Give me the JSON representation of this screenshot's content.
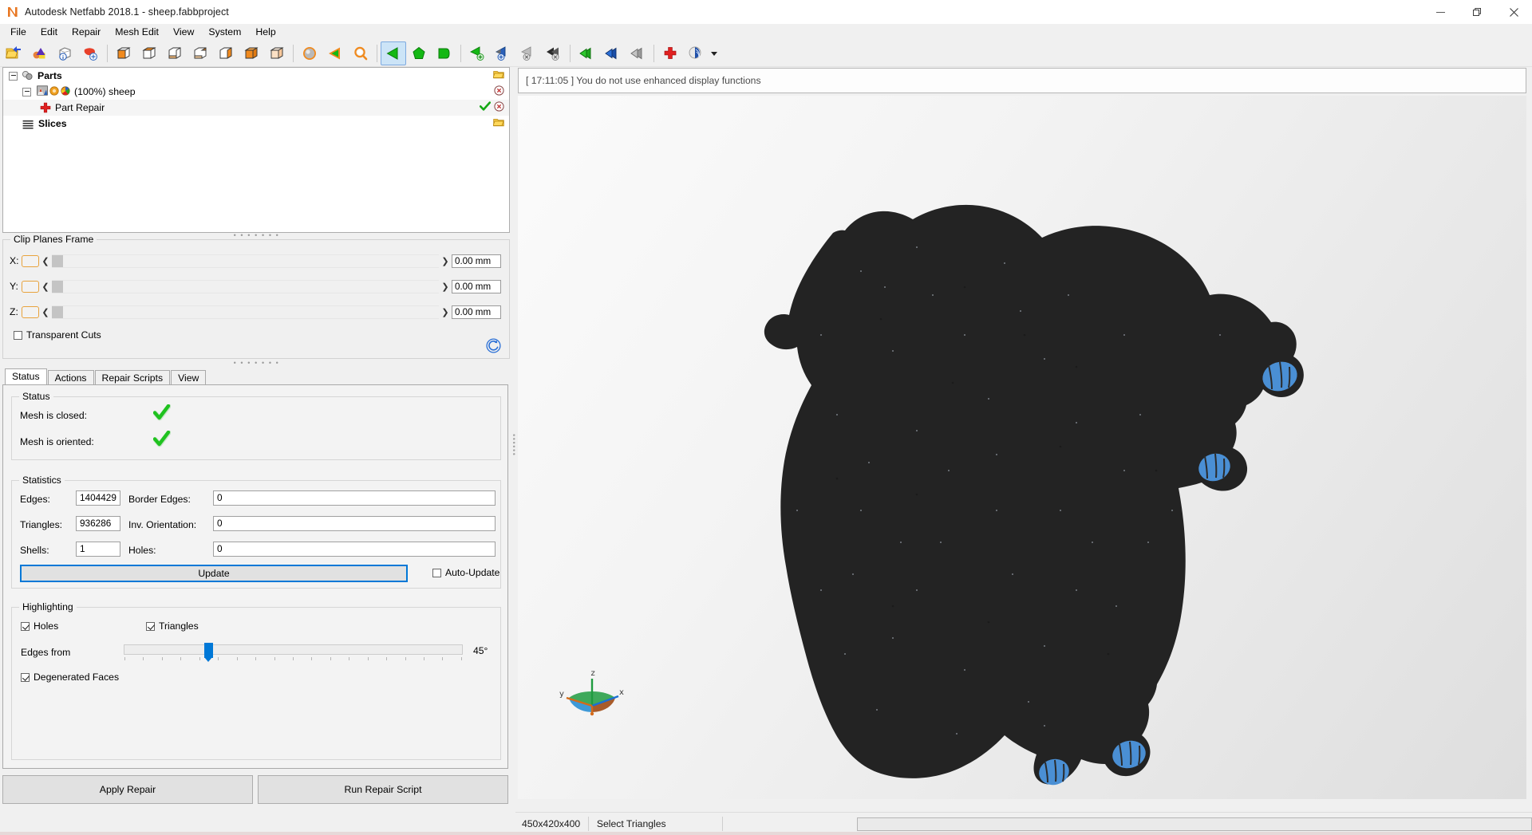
{
  "window": {
    "title": "Autodesk Netfabb 2018.1 - sheep.fabbproject",
    "logo_letter": "N",
    "controls": {
      "minimize": "minimize-icon",
      "maximize": "maximize-icon",
      "close": "close-icon"
    }
  },
  "menu": {
    "items": [
      {
        "label": "File"
      },
      {
        "label": "Edit"
      },
      {
        "label": "Repair"
      },
      {
        "label": "Mesh Edit"
      },
      {
        "label": "View"
      },
      {
        "label": "System"
      },
      {
        "label": "Help"
      }
    ]
  },
  "toolbar": {
    "groups": [
      {
        "buttons": [
          {
            "name": "open-project-icon",
            "tooltip": "Open Project"
          },
          {
            "name": "import-part-icon",
            "tooltip": "Import Part"
          },
          {
            "name": "part-info-icon",
            "tooltip": "Part Info"
          },
          {
            "name": "add-part-icon",
            "tooltip": "Add Part"
          }
        ]
      },
      {
        "buttons": [
          {
            "name": "view-cube-1-icon",
            "tooltip": "View Front"
          },
          {
            "name": "view-cube-2-icon",
            "tooltip": "View Top"
          },
          {
            "name": "view-cube-3-icon",
            "tooltip": "View Bottom"
          },
          {
            "name": "view-cube-4-icon",
            "tooltip": "View Left"
          },
          {
            "name": "view-cube-5-icon",
            "tooltip": "View Right"
          },
          {
            "name": "view-cube-6-icon",
            "tooltip": "View Back"
          },
          {
            "name": "view-cube-7-icon",
            "tooltip": "View Iso"
          }
        ]
      },
      {
        "buttons": [
          {
            "name": "shaded-sphere-icon",
            "tooltip": "Shading"
          },
          {
            "name": "orange-triangle-icon",
            "tooltip": "Triangle Display"
          },
          {
            "name": "zoom-icon",
            "tooltip": "Zoom"
          }
        ]
      },
      {
        "buttons": [
          {
            "name": "select-triangles-icon",
            "tooltip": "Select Triangles",
            "active": true
          },
          {
            "name": "select-surface-icon",
            "tooltip": "Select Surface"
          },
          {
            "name": "select-shell-icon",
            "tooltip": "Select Shell"
          }
        ]
      },
      {
        "buttons": [
          {
            "name": "add-selection-icon",
            "tooltip": "Add to Selection"
          },
          {
            "name": "invert-selection-icon",
            "tooltip": "Invert Selection"
          },
          {
            "name": "remove-selection-icon",
            "tooltip": "Remove from Selection"
          },
          {
            "name": "clear-selection-icon",
            "tooltip": "Clear Selection"
          }
        ]
      },
      {
        "buttons": [
          {
            "name": "select-green-icon",
            "tooltip": "Select"
          },
          {
            "name": "select-blue-icon",
            "tooltip": "Select Blue"
          },
          {
            "name": "select-gray-icon",
            "tooltip": "Deselect"
          }
        ]
      },
      {
        "buttons": [
          {
            "name": "repair-cross-icon",
            "tooltip": "Repair Part"
          },
          {
            "name": "render-mode-icon",
            "tooltip": "Render Mode",
            "has_dropdown": true
          }
        ]
      }
    ]
  },
  "tree": {
    "nodes": [
      {
        "label": "Parts",
        "bold": true,
        "icon": "parts-icon",
        "expander": "minus",
        "right_icons": [
          "folder-open-icon"
        ],
        "level": 0
      },
      {
        "label": "(100%) sheep",
        "bold": false,
        "icon": "mesh-part-icon",
        "extra_icons": [
          "orange-dot-icon",
          "color-wheel-icon"
        ],
        "expander": "minus",
        "right_icons": [
          "remove-icon"
        ],
        "level": 1
      },
      {
        "label": "Part Repair",
        "bold": false,
        "icon": "repair-cross-icon",
        "expander": "none",
        "right_icons": [
          "check-icon",
          "remove-icon"
        ],
        "selected": true,
        "level": 2
      },
      {
        "label": "Slices",
        "bold": true,
        "icon": "slices-icon",
        "expander": "none",
        "right_icons": [
          "folder-open-icon"
        ],
        "level": 0
      }
    ]
  },
  "clip_planes": {
    "title": "Clip Planes Frame",
    "axes": [
      {
        "label": "X:",
        "value": "0.00 mm",
        "swatch_color": "#e8a33d",
        "thumb_pos": 0
      },
      {
        "label": "Y:",
        "value": "0.00 mm",
        "swatch_color": "#e8a33d",
        "thumb_pos": 0
      },
      {
        "label": "Z:",
        "value": "0.00 mm",
        "swatch_color": "#e8a33d",
        "thumb_pos": 0
      }
    ],
    "transparent_cuts": {
      "label": "Transparent Cuts",
      "checked": false
    },
    "reset_icon": "reset-circular-arrow-icon"
  },
  "tabs": {
    "items": [
      {
        "label": "Status",
        "active": true
      },
      {
        "label": "Actions",
        "active": false
      },
      {
        "label": "Repair Scripts",
        "active": false
      },
      {
        "label": "View",
        "active": false
      }
    ]
  },
  "status_group": {
    "title": "Status",
    "rows": [
      {
        "label": "Mesh is closed:",
        "value_icon": "green-check-icon"
      },
      {
        "label": "Mesh is oriented:",
        "value_icon": "green-check-icon"
      }
    ]
  },
  "statistics_group": {
    "title": "Statistics",
    "rows": [
      {
        "left_label": "Edges:",
        "left_value": "1404429",
        "right_label": "Border Edges:",
        "right_value": "0"
      },
      {
        "left_label": "Triangles:",
        "left_value": "936286",
        "right_label": "Inv. Orientation:",
        "right_value": "0"
      },
      {
        "left_label": "Shells:",
        "left_value": "1",
        "right_label": "Holes:",
        "right_value": "0"
      }
    ],
    "update_button": "Update",
    "auto_update": {
      "label": "Auto-Update",
      "checked": false
    }
  },
  "highlighting_group": {
    "title": "Highlighting",
    "holes": {
      "label": "Holes",
      "checked": true
    },
    "triangles": {
      "label": "Triangles",
      "checked": true
    },
    "edges_from": {
      "label": "Edges from",
      "value": "45°",
      "slider_percent": 25
    },
    "degenerated_faces": {
      "label": "Degenerated Faces",
      "checked": true
    }
  },
  "actions": {
    "apply_repair": "Apply Repair",
    "run_repair_script": "Run Repair Script"
  },
  "log": {
    "message": "[ 17:11:05 ] You do not use enhanced display functions"
  },
  "viewport": {
    "model_name": "sheep",
    "model_color": "#232323",
    "highlight_color": "#4a8fd4",
    "gizmo": {
      "x_label": "x",
      "y_label": "y",
      "z_label": "z",
      "x_color": "#1a6fd4",
      "y_color": "#d46a1a",
      "z_color": "#1f9b3f"
    }
  },
  "statusbar": {
    "dimensions": "450x420x400",
    "mode": "Select Triangles",
    "progress_value": ""
  }
}
